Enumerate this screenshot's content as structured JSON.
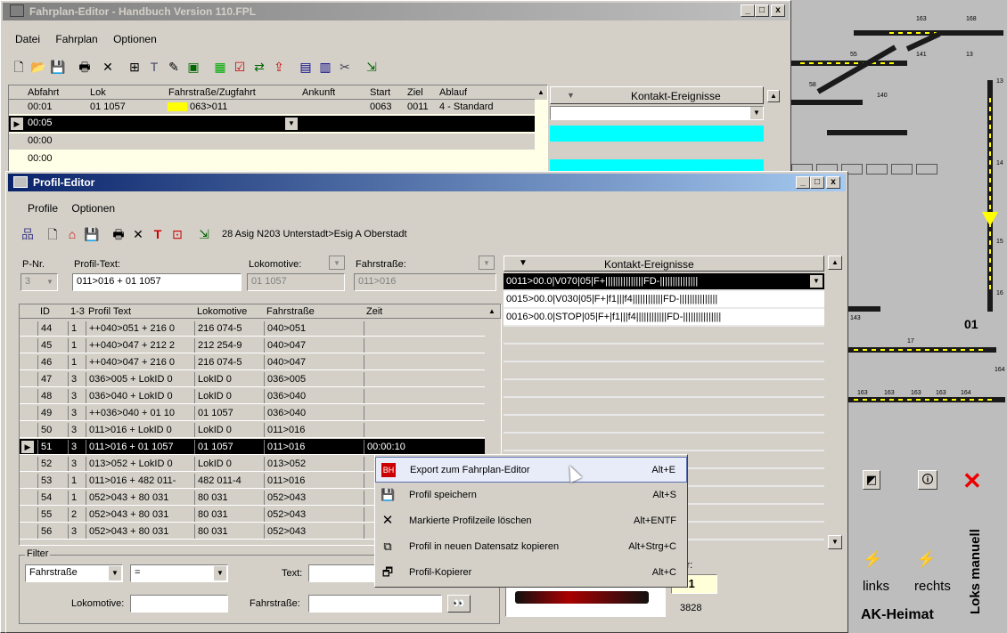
{
  "main_window": {
    "title": "Fahrplan-Editor - Handbuch Version 110.FPL",
    "menu": [
      "Datei",
      "Fahrplan",
      "Optionen"
    ],
    "columns": [
      "Abfahrt",
      "Lok",
      "Fahrstraße/Zugfahrt",
      "Ankunft",
      "Start",
      "Ziel",
      "Ablauf"
    ],
    "row1": {
      "abfahrt": "00:01",
      "lok": "01 1057",
      "fahrstrasse": "063>011",
      "start": "0063",
      "ziel": "0011",
      "ablauf": "4 - Standard"
    },
    "row2": {
      "abfahrt": "00:05"
    },
    "row3": {
      "abfahrt": "00:00"
    },
    "row4": {
      "abfahrt": "00:00"
    },
    "kontakt_header": "Kontakt-Ereignisse"
  },
  "profil_window": {
    "title": "Profil-Editor",
    "menu": [
      "Profile",
      "Optionen"
    ],
    "toolbar_caption": "28 Asig N203 Unterstadt>Esig A Oberstadt",
    "fields": {
      "pnr_label": "P-Nr.",
      "pnr_value": "3",
      "text_label": "Profil-Text:",
      "text_value": "011>016 + 01 1057",
      "lok_label": "Lokomotive:",
      "lok_value": "01 1057",
      "fs_label": "Fahrstraße:",
      "fs_value": "011>016"
    },
    "columns": [
      "ID",
      "1-3",
      "Profil Text",
      "Lokomotive",
      "Fahrstraße",
      "Zeit"
    ],
    "rows": [
      [
        "44",
        "1",
        "++040>051 + 216 0",
        "216 074-5",
        "040>051",
        ""
      ],
      [
        "45",
        "1",
        "++040>047 + 212 2",
        "212 254-9",
        "040>047",
        ""
      ],
      [
        "46",
        "1",
        "++040>047 + 216 0",
        "216 074-5",
        "040>047",
        ""
      ],
      [
        "47",
        "3",
        "036>005 + LokID 0",
        "LokID 0",
        "036>005",
        ""
      ],
      [
        "48",
        "3",
        "036>040 + LokID 0",
        "LokID 0",
        "036>040",
        ""
      ],
      [
        "49",
        "3",
        "++036>040 + 01 10",
        "01 1057",
        "036>040",
        ""
      ],
      [
        "50",
        "3",
        "011>016 + LokID 0",
        "LokID 0",
        "011>016",
        ""
      ],
      [
        "51",
        "3",
        "011>016 + 01 1057",
        "01 1057",
        "011>016",
        "00:00:10"
      ],
      [
        "52",
        "3",
        "013>052 + LokID 0",
        "LokID 0",
        "013>052",
        ""
      ],
      [
        "53",
        "1",
        "011>016 + 482 011-",
        "482 011-4",
        "011>016",
        ""
      ],
      [
        "54",
        "1",
        "052>043 + 80 031",
        "80 031",
        "052>043",
        ""
      ],
      [
        "55",
        "2",
        "052>043 + 80 031",
        "80 031",
        "052>043",
        ""
      ],
      [
        "56",
        "3",
        "052>043 + 80 031",
        "80 031",
        "052>043",
        ""
      ]
    ],
    "kontakt_header": "Kontakt-Ereignisse",
    "kontakt_rows": [
      "0011>00.0|V070|05|F+|||||||||||||||FD-|||||||||||||||",
      "0015>00.0|V030|05|F+|f1|||f4||||||||||||FD-|||||||||||||||",
      "0016>00.0|STOP|05|F+|f1|||f4||||||||||||FD-|||||||||||||||"
    ],
    "filter": {
      "label": "Filter",
      "select1": "Fahrstraße",
      "select2": "=",
      "text_label": "Text:",
      "lok_label": "Lokomotive:",
      "fs_label": "Fahrstraße:"
    },
    "adr_label": "Adr:",
    "adr_value": "001",
    "num": "3828"
  },
  "context_menu": [
    {
      "label": "Export zum Fahrplan-Editor",
      "shortcut": "Alt+E",
      "icon": "export-icon"
    },
    {
      "label": "Profil speichern",
      "shortcut": "Alt+S",
      "icon": "floppy-disk-icon"
    },
    {
      "label": "Markierte Profilzeile löschen",
      "shortcut": "Alt+ENTF",
      "icon": "delete-x-icon"
    },
    {
      "label": "Profil in neuen Datensatz kopieren",
      "shortcut": "Alt+Strg+C",
      "icon": "copy-icon"
    },
    {
      "label": "Profil-Kopierer",
      "shortcut": "Alt+C",
      "icon": "windows-icon"
    }
  ],
  "layout_panel": {
    "labels": [
      "163",
      "168",
      "55",
      "141",
      "13",
      "58",
      "140",
      "13",
      "14",
      "15",
      "16",
      "143",
      "17",
      "01",
      "164",
      "163",
      "163",
      "163",
      "163",
      "164"
    ],
    "links": "links",
    "rechts": "rechts",
    "loks_manuell": "Loks manuell",
    "ak_heimat": "AK-Heimat"
  },
  "colors": {
    "titlebar_active": "#0a246a",
    "titlebar_inactive": "#808080",
    "selection": "#000000",
    "cyan": "#00ffff",
    "track_yellow": "#ffff00"
  }
}
